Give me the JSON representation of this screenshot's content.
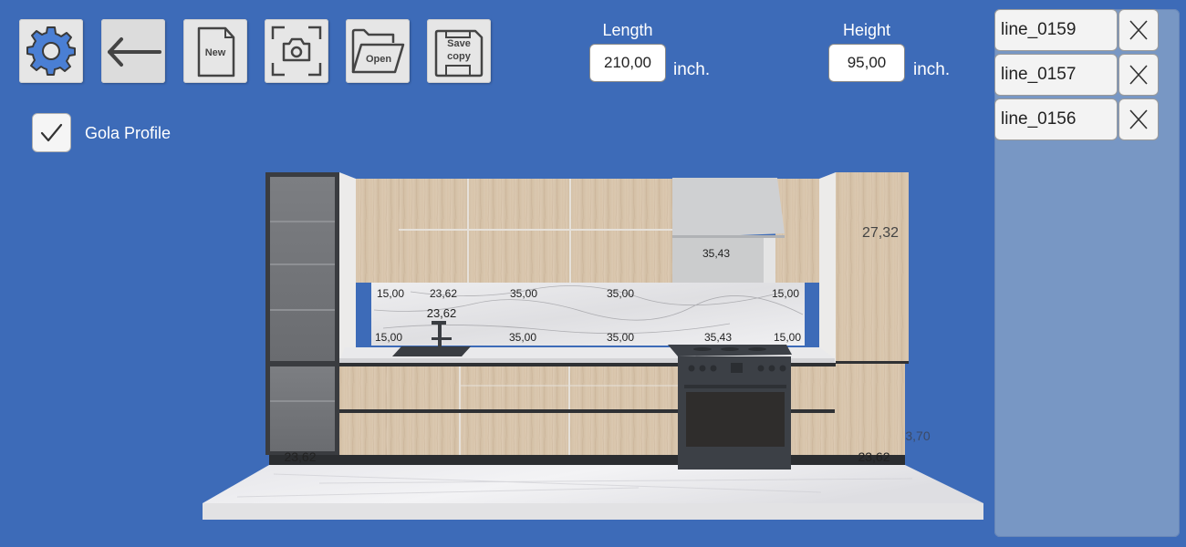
{
  "toolbar": {
    "settings": {
      "icon": "gear-icon"
    },
    "back": {
      "icon": "arrow-left-icon"
    },
    "new": {
      "icon": "new-document-icon",
      "label": "New"
    },
    "screenshot": {
      "icon": "camera-icon"
    },
    "open": {
      "icon": "folder-open-icon",
      "label": "Open"
    },
    "save_copy": {
      "icon": "floppy-disk-icon",
      "label_line1": "Save",
      "label_line2": "copy"
    }
  },
  "dimensions": {
    "length": {
      "label": "Length",
      "value": "210,00",
      "unit": "inch."
    },
    "height": {
      "label": "Height",
      "value": "95,00",
      "unit": "inch."
    }
  },
  "gola_profile": {
    "label": "Gola Profile",
    "checked": true
  },
  "lines_panel": {
    "items": [
      {
        "name": "line_0159"
      },
      {
        "name": "line_0157"
      },
      {
        "name": "line_0156"
      }
    ]
  },
  "scene": {
    "dimension_labels": {
      "upper_left_15": "15,00",
      "upper_sink_23": "23,62",
      "upper_35_a": "35,00",
      "upper_35_b": "35,00",
      "hood_35_43": "35,43",
      "upper_right_15": "15,00",
      "sink_23_62": "23,62",
      "lower_left_15": "15,00",
      "lower_35_a": "35,00",
      "lower_35_b": "35,00",
      "stove_35_43": "35,43",
      "lower_right_15": "15,00",
      "tall_right_27_32": "27,32",
      "fridge_23_62": "23,62",
      "tall_right_23_62": "23,62",
      "plinth_3_70": "3,70"
    },
    "colors": {
      "background": "#3d6bb8",
      "wood": "#d9c6ae",
      "dark": "#35383c",
      "marble": "#e8e8ea",
      "panel": "#7897c4"
    }
  }
}
